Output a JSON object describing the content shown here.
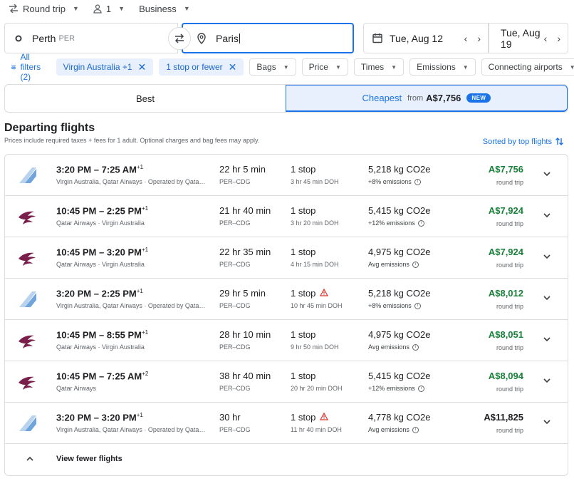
{
  "options": {
    "trip_type": "Round trip",
    "passengers": "1",
    "cabin": "Business"
  },
  "search": {
    "origin": "Perth",
    "origin_code": "PER",
    "destination": "Paris",
    "depart_date": "Tue, Aug 12",
    "return_date": "Tue, Aug 19"
  },
  "filters": {
    "all_filters": "All filters (2)",
    "chips": [
      {
        "label": "Virgin Australia +1",
        "selected": true
      },
      {
        "label": "1 stop or fewer",
        "selected": true
      },
      {
        "label": "Bags",
        "selected": false
      },
      {
        "label": "Price",
        "selected": false
      },
      {
        "label": "Times",
        "selected": false
      },
      {
        "label": "Emissions",
        "selected": false
      },
      {
        "label": "Connecting airports",
        "selected": false
      }
    ]
  },
  "tabs": {
    "best": "Best",
    "cheapest": "Cheapest",
    "cheapest_from": "from",
    "cheapest_amount": "A$7,756",
    "new_badge": "NEW"
  },
  "section": {
    "title": "Departing flights",
    "subtitle": "Prices include required taxes + fees for 1 adult. Optional charges and bag fees may apply.",
    "sort_label": "Sorted by top flights"
  },
  "flights": [
    {
      "logo": "virgin-australia-logo",
      "times": "3:20 PM – 7:25 AM",
      "day_offset": "+1",
      "airlines": "Virgin Australia, Qatar Airways · Operated by Qata…",
      "duration": "22 hr 5 min",
      "route": "PER–CDG",
      "stops": "1 stop",
      "warning": false,
      "stop_detail": "3 hr 45 min DOH",
      "co2": "5,218 kg CO2e",
      "emissions": "+8% emissions",
      "price": "A$7,756",
      "price_green": true,
      "price_note": "round trip"
    },
    {
      "logo": "qatar-airways-logo",
      "times": "10:45 PM – 2:25 PM",
      "day_offset": "+1",
      "airlines": "Qatar Airways · Virgin Australia",
      "duration": "21 hr 40 min",
      "route": "PER–CDG",
      "stops": "1 stop",
      "warning": false,
      "stop_detail": "3 hr 20 min DOH",
      "co2": "5,415 kg CO2e",
      "emissions": "+12% emissions",
      "price": "A$7,924",
      "price_green": true,
      "price_note": "round trip"
    },
    {
      "logo": "qatar-airways-logo",
      "times": "10:45 PM – 3:20 PM",
      "day_offset": "+1",
      "airlines": "Qatar Airways · Virgin Australia",
      "duration": "22 hr 35 min",
      "route": "PER–CDG",
      "stops": "1 stop",
      "warning": false,
      "stop_detail": "4 hr 15 min DOH",
      "co2": "4,975 kg CO2e",
      "emissions": "Avg emissions",
      "price": "A$7,924",
      "price_green": true,
      "price_note": "round trip"
    },
    {
      "logo": "virgin-australia-logo",
      "times": "3:20 PM – 2:25 PM",
      "day_offset": "+1",
      "airlines": "Virgin Australia, Qatar Airways · Operated by Qata…",
      "duration": "29 hr 5 min",
      "route": "PER–CDG",
      "stops": "1 stop",
      "warning": true,
      "stop_detail": "10 hr 45 min DOH",
      "co2": "5,218 kg CO2e",
      "emissions": "+8% emissions",
      "price": "A$8,012",
      "price_green": true,
      "price_note": "round trip"
    },
    {
      "logo": "qatar-airways-logo",
      "times": "10:45 PM – 8:55 PM",
      "day_offset": "+1",
      "airlines": "Qatar Airways · Virgin Australia",
      "duration": "28 hr 10 min",
      "route": "PER–CDG",
      "stops": "1 stop",
      "warning": false,
      "stop_detail": "9 hr 50 min DOH",
      "co2": "4,975 kg CO2e",
      "emissions": "Avg emissions",
      "price": "A$8,051",
      "price_green": true,
      "price_note": "round trip"
    },
    {
      "logo": "qatar-airways-logo",
      "times": "10:45 PM – 7:25 AM",
      "day_offset": "+2",
      "airlines": "Qatar Airways",
      "duration": "38 hr 40 min",
      "route": "PER–CDG",
      "stops": "1 stop",
      "warning": false,
      "stop_detail": "20 hr 20 min DOH",
      "co2": "5,415 kg CO2e",
      "emissions": "+12% emissions",
      "price": "A$8,094",
      "price_green": true,
      "price_note": "round trip"
    },
    {
      "logo": "virgin-australia-logo",
      "times": "3:20 PM – 3:20 PM",
      "day_offset": "+1",
      "airlines": "Virgin Australia, Qatar Airways · Operated by Qata…",
      "duration": "30 hr",
      "route": "PER–CDG",
      "stops": "1 stop",
      "warning": true,
      "stop_detail": "11 hr 40 min DOH",
      "co2": "4,778 kg CO2e",
      "emissions": "Avg emissions",
      "price": "A$11,825",
      "price_green": false,
      "price_note": "round trip"
    }
  ],
  "footer": {
    "view_fewer": "View fewer flights"
  }
}
